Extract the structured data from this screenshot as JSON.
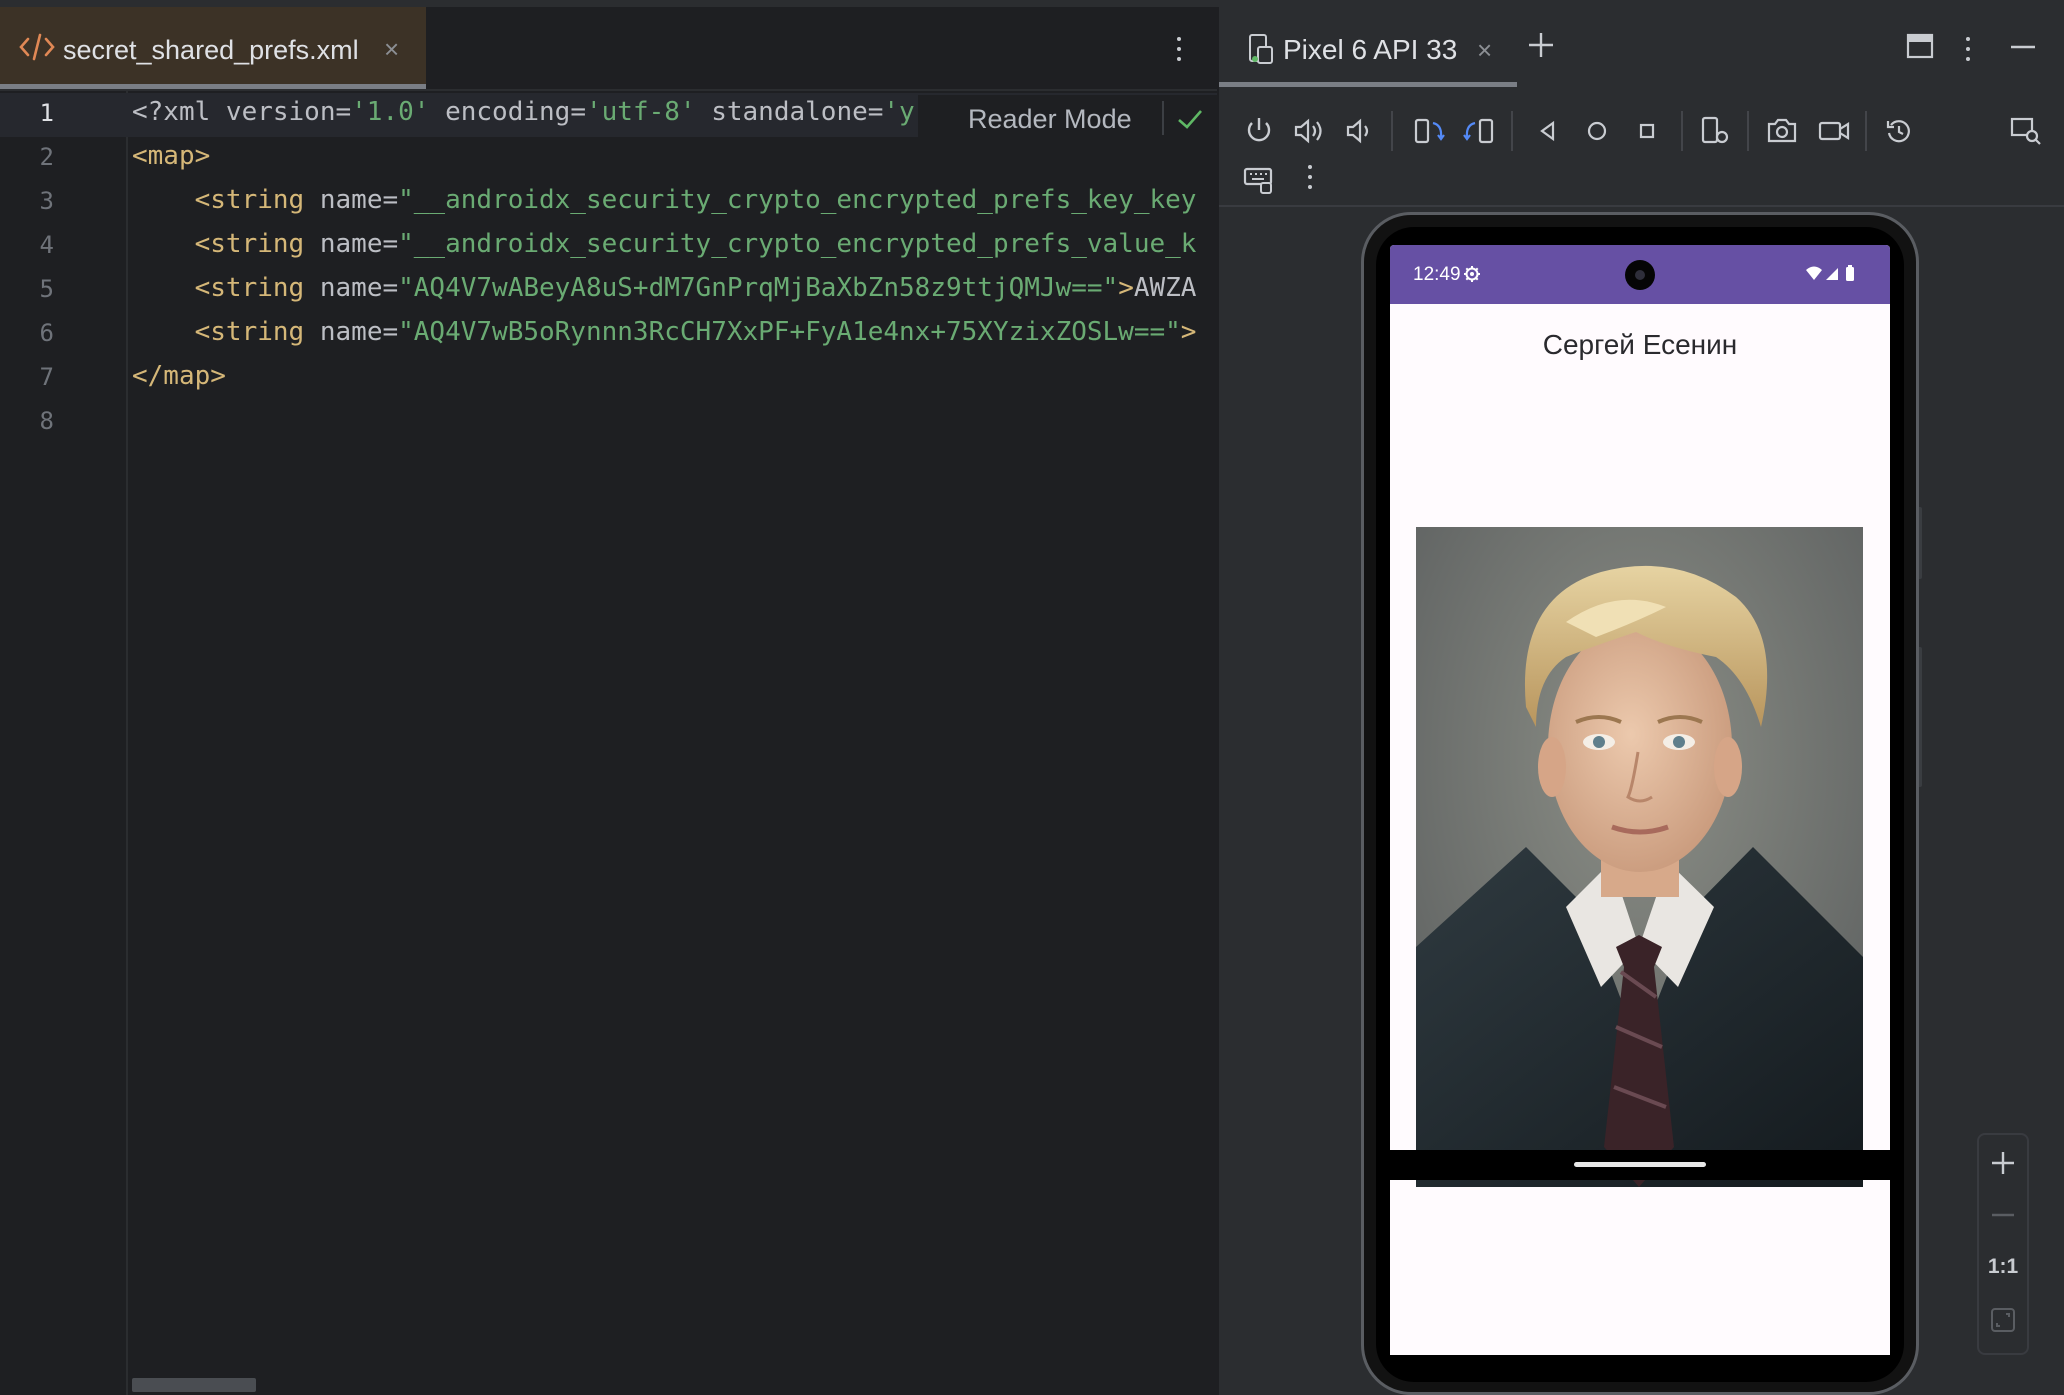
{
  "editor": {
    "tab": {
      "label": "secret_shared_prefs.xml",
      "close": "×"
    },
    "reader_mode": "Reader Mode",
    "line_numbers": [
      "1",
      "2",
      "3",
      "4",
      "5",
      "6",
      "7",
      "8"
    ],
    "lines": [
      {
        "decl": "<?xml version=",
        "s1": "'1.0'",
        "d2": " encoding=",
        "s2": "'utf-8'",
        "d3": " standalone=",
        "s3": "'y"
      },
      {
        "tag": "<map>"
      },
      {
        "indent": "    ",
        "tag": "<string",
        "attr": " name=",
        "str": "\"__androidx_security_crypto_encrypted_prefs_key_key"
      },
      {
        "indent": "    ",
        "tag": "<string",
        "attr": " name=",
        "str": "\"__androidx_security_crypto_encrypted_prefs_value_k"
      },
      {
        "indent": "    ",
        "tag": "<string",
        "attr": " name=",
        "str": "\"AQ4V7wABeyA8uS+dM7GnPrqMjBaXbZn58z9ttjQMJw==\"",
        "end": ">",
        "text": "AWZA"
      },
      {
        "indent": "    ",
        "tag": "<string",
        "attr": " name=",
        "str": "\"AQ4V7wB5oRynnn3RcCH7XxPF+FyA1e4nx+75XYzixZOSLw==\"",
        "end": ">"
      },
      {
        "tag": "</map>"
      },
      {}
    ]
  },
  "emulator": {
    "device_title": "Pixel 6 API 33",
    "close": "×",
    "screen": {
      "time": "12:49",
      "name": "Сергей Есенин"
    },
    "zoom_one_to_one": "1:1"
  },
  "colors": {
    "status_bar": "#6650a4",
    "string": "#6aab73",
    "tag": "#d5b778",
    "accent_icon": "#548af7"
  }
}
